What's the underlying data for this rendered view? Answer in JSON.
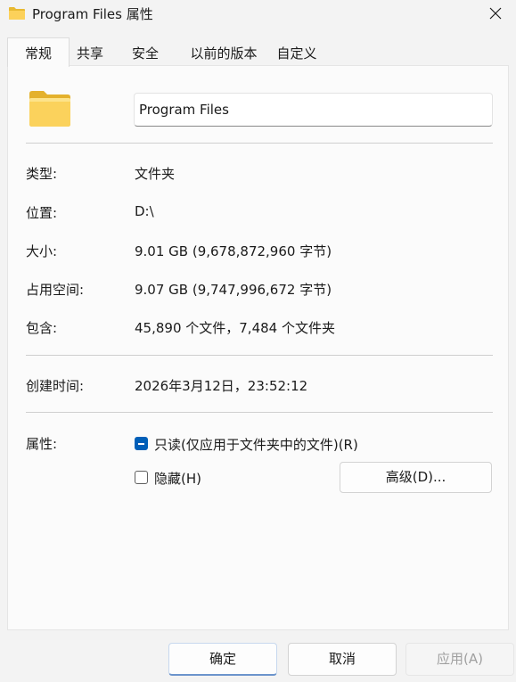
{
  "window": {
    "title": "Program Files 属性",
    "close_icon": "close-icon"
  },
  "tabs": [
    "常规",
    "共享",
    "安全",
    "以前的版本",
    "自定义"
  ],
  "general": {
    "folder_icon": "folder-icon",
    "name": "Program Files",
    "rows": [
      {
        "label": "类型:",
        "value": "文件夹"
      },
      {
        "label": "位置:",
        "value": "D:\\"
      },
      {
        "label": "大小:",
        "value": "9.01 GB (9,678,872,960 字节)"
      },
      {
        "label": "占用空间:",
        "value": "9.07 GB (9,747,996,672 字节)"
      },
      {
        "label": "包含:",
        "value": "45,890 个文件，7,484 个文件夹"
      }
    ],
    "created_label": "创建时间:",
    "created_value": "2026年3月12日，23:52:12",
    "attributes_label": "属性:",
    "readonly_label": "只读(仅应用于文件夹中的文件)(R)",
    "readonly_state": "mixed",
    "hidden_label": "隐藏(H)",
    "hidden_state": "unchecked",
    "advanced_button": "高级(D)..."
  },
  "footer": {
    "ok": "确定",
    "cancel": "取消",
    "apply": "应用(A)"
  },
  "colors": {
    "accent": "#005fb8",
    "background": "#f3f3f3",
    "panel": "#fbfbfb"
  }
}
